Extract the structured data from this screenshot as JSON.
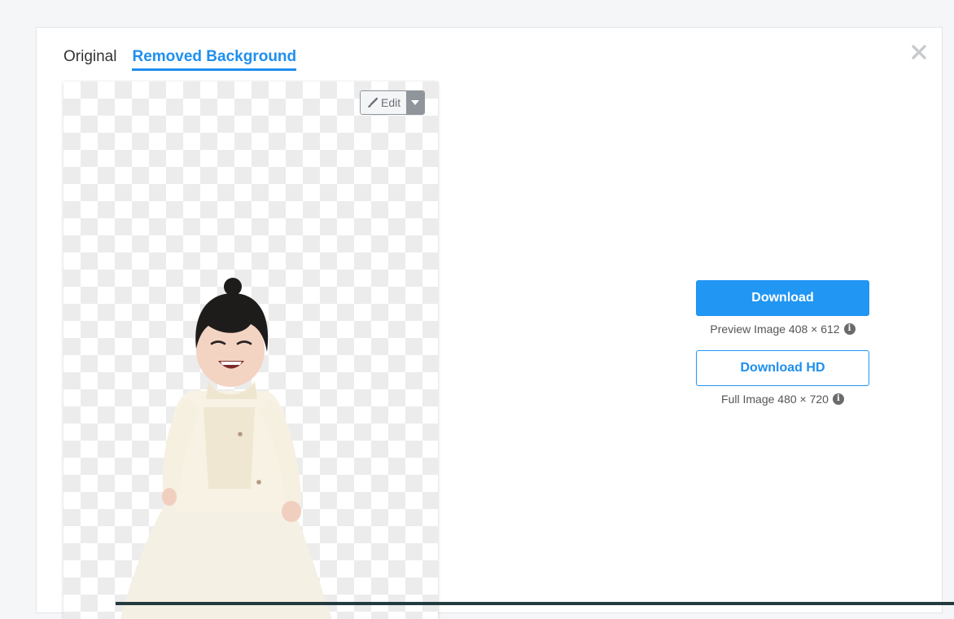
{
  "tabs": [
    {
      "label": "Original",
      "active": false
    },
    {
      "label": "Removed Background",
      "active": true
    }
  ],
  "editor": {
    "edit_label": "Edit"
  },
  "download": {
    "primary_label": "Download",
    "preview_info": "Preview Image 408 × 612",
    "hd_label": "Download HD",
    "hd_info": "Full Image 480 × 720"
  },
  "colors": {
    "accent": "#2196f3",
    "tab_active": "#1f8fee"
  },
  "icons": {
    "close": "close-icon",
    "edit": "brush-icon",
    "caret": "caret-down-icon",
    "info": "info-icon"
  }
}
